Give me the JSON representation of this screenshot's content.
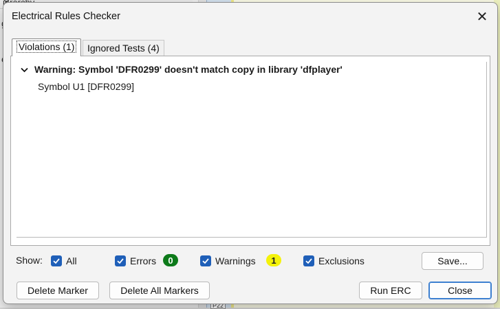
{
  "background": {
    "left_panel_title": "ierarchy",
    "left_letter_top": "g",
    "left_letter_mid": "e",
    "canvas_label": "P22"
  },
  "dialog": {
    "title": "Electrical Rules Checker",
    "close_glyph": "✕"
  },
  "tabs": [
    {
      "label": "Violations (1)",
      "active": true
    },
    {
      "label": "Ignored Tests (4)",
      "active": false
    }
  ],
  "violations": [
    {
      "expanded": true,
      "message": "Warning: Symbol 'DFR0299' doesn't match copy in library 'dfplayer'",
      "items": [
        "Symbol U1 [DFR0299]"
      ]
    }
  ],
  "show": {
    "label": "Show:",
    "filters": [
      {
        "label": "All",
        "checked": true
      },
      {
        "label": "Errors",
        "checked": true,
        "count": "0",
        "count_color": "#0d7a1a"
      },
      {
        "label": "Warnings",
        "checked": true,
        "count": "1",
        "count_color": "#f4f20a"
      },
      {
        "label": "Exclusions",
        "checked": true
      }
    ],
    "save_label": "Save..."
  },
  "buttons": {
    "delete_marker": "Delete Marker",
    "delete_all_markers": "Delete All Markers",
    "run_erc": "Run ERC",
    "close": "Close"
  },
  "colors": {
    "checkbox_accent": "#1f5fb8",
    "primary_button_border": "#3c7fd0"
  }
}
